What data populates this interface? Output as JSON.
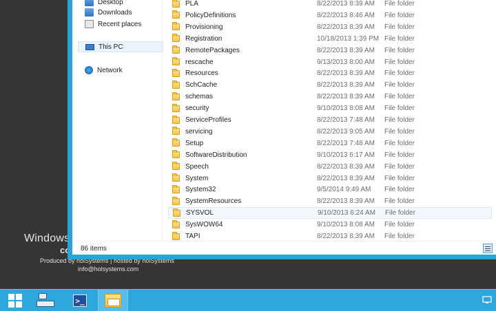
{
  "desktop": {
    "title": "Windows",
    "subtitle": "co",
    "credit": "Produced by holSystems | hosted by holSystems",
    "email": "info@holsystems.com"
  },
  "nav": {
    "items": [
      {
        "label": "Desktop",
        "icon": "desktop-icon"
      },
      {
        "label": "Downloads",
        "icon": "downloads-icon"
      },
      {
        "label": "Recent places",
        "icon": "recent-places-icon"
      },
      {
        "label": "This PC",
        "icon": "computer-icon",
        "selected": true
      },
      {
        "label": "Network",
        "icon": "network-icon"
      }
    ]
  },
  "files": [
    {
      "name": "PLA",
      "date": "8/22/2013 8:39 AM",
      "type": "File folder"
    },
    {
      "name": "PolicyDefinitions",
      "date": "8/22/2013 8:46 AM",
      "type": "File folder"
    },
    {
      "name": "Provisioning",
      "date": "8/22/2013 8:39 AM",
      "type": "File folder"
    },
    {
      "name": "Registration",
      "date": "10/18/2013 1:39 PM",
      "type": "File folder"
    },
    {
      "name": "RemotePackages",
      "date": "8/22/2013 8:39 AM",
      "type": "File folder"
    },
    {
      "name": "rescache",
      "date": "9/13/2013 8:00 AM",
      "type": "File folder"
    },
    {
      "name": "Resources",
      "date": "8/22/2013 8:39 AM",
      "type": "File folder"
    },
    {
      "name": "SchCache",
      "date": "8/22/2013 8:39 AM",
      "type": "File folder"
    },
    {
      "name": "schemas",
      "date": "8/22/2013 8:39 AM",
      "type": "File folder"
    },
    {
      "name": "security",
      "date": "9/10/2013 8:08 AM",
      "type": "File folder"
    },
    {
      "name": "ServiceProfiles",
      "date": "8/22/2013 7:48 AM",
      "type": "File folder"
    },
    {
      "name": "servicing",
      "date": "8/22/2013 9:05 AM",
      "type": "File folder"
    },
    {
      "name": "Setup",
      "date": "8/22/2013 7:48 AM",
      "type": "File folder"
    },
    {
      "name": "SoftwareDistribution",
      "date": "9/10/2013 6:17 AM",
      "type": "File folder"
    },
    {
      "name": "Speech",
      "date": "8/22/2013 8:39 AM",
      "type": "File folder"
    },
    {
      "name": "System",
      "date": "8/22/2013 8:39 AM",
      "type": "File folder"
    },
    {
      "name": "System32",
      "date": "9/5/2014 9:49 AM",
      "type": "File folder"
    },
    {
      "name": "SystemResources",
      "date": "8/22/2013 8:39 AM",
      "type": "File folder"
    },
    {
      "name": "SYSVOL",
      "date": "9/10/2013 6:24 AM",
      "type": "File folder",
      "selected": true
    },
    {
      "name": "SysWOW64",
      "date": "9/10/2013 8:08 AM",
      "type": "File folder"
    },
    {
      "name": "TAPI",
      "date": "8/22/2013 8:39 AM",
      "type": "File folder"
    }
  ],
  "status": {
    "item_count": "86 items"
  },
  "taskbar": {
    "items": [
      {
        "icon": "windows-start-icon"
      },
      {
        "icon": "server-manager-icon"
      },
      {
        "icon": "powershell-icon",
        "glyph": ">_"
      },
      {
        "icon": "file-explorer-icon",
        "active": true
      }
    ]
  },
  "colors": {
    "accent": "#2ea8dc",
    "window_border": "#2aa3d8",
    "desktop_bg": "#353535",
    "selection": "#eaf3fb"
  }
}
